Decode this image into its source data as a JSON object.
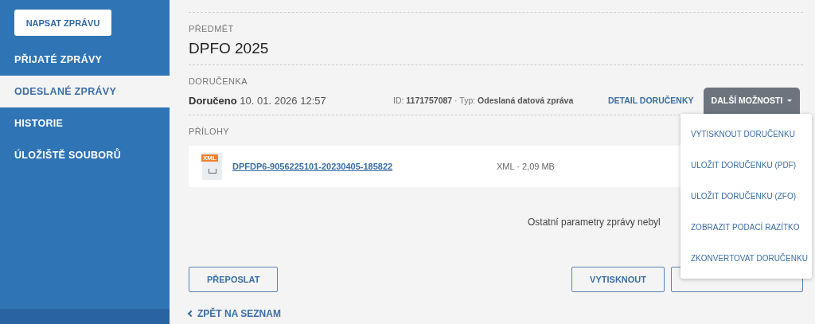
{
  "sidebar": {
    "compose_button": "NAPSAT ZPRÁVU",
    "items": [
      {
        "label": "PŘIJATÉ ZPRÁVY",
        "selected": false
      },
      {
        "label": "ODESLANÉ ZPRÁVY",
        "selected": true
      },
      {
        "label": "HISTORIE",
        "selected": false
      },
      {
        "label": "ÚLOŽIŠTĚ SOUBORŮ",
        "selected": false
      }
    ]
  },
  "subject": {
    "label": "PŘEDMĚT",
    "value": "DPFO 2025"
  },
  "receipt": {
    "label": "DORUČENKA",
    "status": "Doručeno",
    "datetime": "10. 01. 2026 12:57",
    "id_label": "ID:",
    "id": "1171757087",
    "separator": "·",
    "type_label": "Typ:",
    "type": "Odeslaná datová zpráva",
    "detail_link": "DETAIL DORUČENKY",
    "more_button": "DALŠÍ MOŽNOSTI"
  },
  "attachments": {
    "label": "PŘÍLOHY",
    "files": [
      {
        "badge": "XML",
        "name": "DPFDP6-9056225101-20230405-185822",
        "meta": "XML · 2,09 MB"
      }
    ]
  },
  "notice": "Ostatní parametry zprávy nebyl",
  "actions": {
    "left": [
      "PŘEPOSLAT"
    ],
    "right": [
      "VYTISKNOUT"
    ]
  },
  "back_link": "ZPĚT NA SEZNAM",
  "dropdown": {
    "items": [
      "VYTISKNOUT DORUČENKU",
      "ULOŽIT DORUČENKU (PDF)",
      "ULOŽIT DORUČENKU (ZFO)",
      "ZOBRAZIT PODACÍ RAZÍTKO",
      "ZKONVERTOVAT DORUČENKU"
    ]
  }
}
